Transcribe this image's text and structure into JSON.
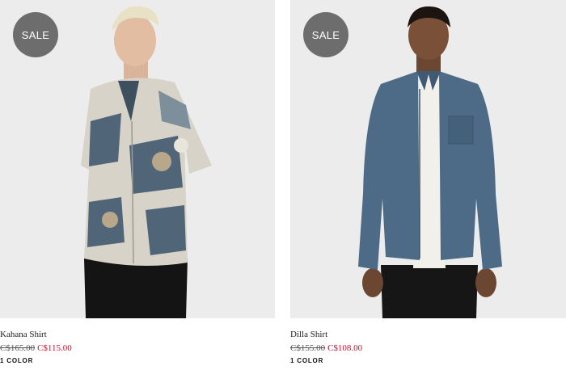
{
  "products": [
    {
      "badge": "SALE",
      "name": "Kahana Shirt",
      "price_original": "C$165.00",
      "price_sale": "C$115.00",
      "colors": "1 COLOR"
    },
    {
      "badge": "SALE",
      "name": "Dilla Shirt",
      "price_original": "C$155.00",
      "price_sale": "C$108.00",
      "colors": "1 COLOR"
    }
  ],
  "colors": {
    "badge_bg": "#6d6d6d",
    "sale_price": "#c8102e",
    "image_bg": "#ececec"
  }
}
